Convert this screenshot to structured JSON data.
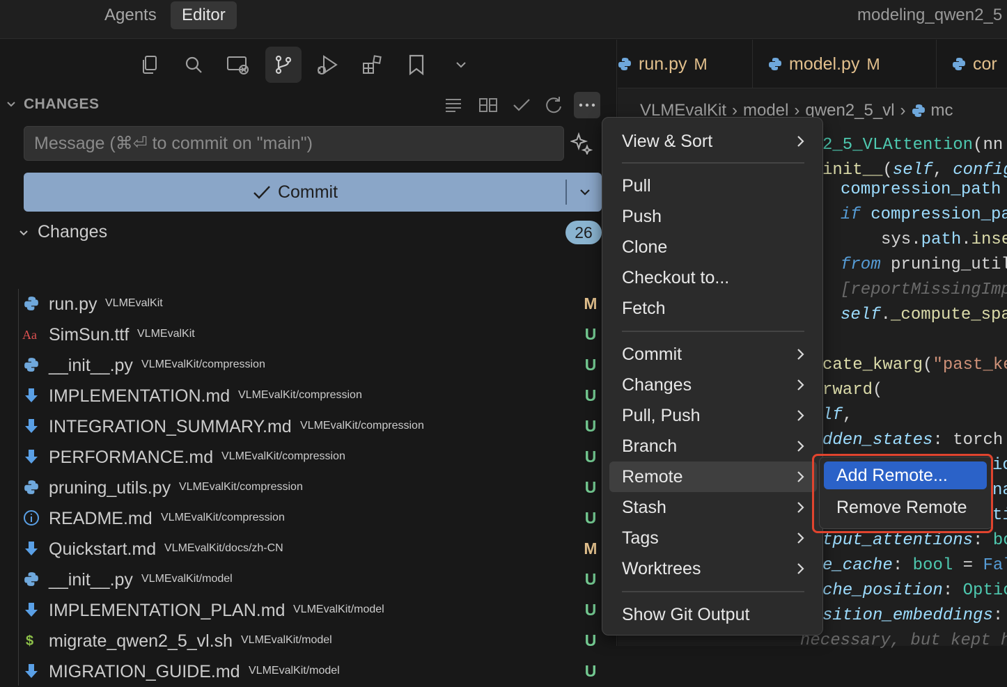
{
  "topbar": {
    "tabs": [
      {
        "label": "Agents"
      },
      {
        "label": "Editor"
      }
    ],
    "window_title": "modeling_qwen2_5"
  },
  "activity": {
    "icons": [
      "explorer-icon",
      "search-icon",
      "remote-explorer-icon",
      "source-control-icon",
      "run-debug-icon",
      "extensions-icon",
      "bookmark-icon",
      "chevron-down-icon"
    ],
    "active": "source-control-icon"
  },
  "scm": {
    "section_title": "CHANGES",
    "message_placeholder": "Message (⌘⏎ to commit on \"main\")",
    "commit_label": "Commit",
    "group": {
      "label": "Changes",
      "count": "26"
    },
    "files": [
      {
        "name": "run.py",
        "path": "VLMEvalKit",
        "status": "M",
        "icon": "python"
      },
      {
        "name": "SimSun.ttf",
        "path": "VLMEvalKit",
        "status": "U",
        "icon": "font"
      },
      {
        "name": "__init__.py",
        "path": "VLMEvalKit/compression",
        "status": "U",
        "icon": "python"
      },
      {
        "name": "IMPLEMENTATION.md",
        "path": "VLMEvalKit/compression",
        "status": "U",
        "icon": "markdown"
      },
      {
        "name": "INTEGRATION_SUMMARY.md",
        "path": "VLMEvalKit/compression",
        "status": "U",
        "icon": "markdown"
      },
      {
        "name": "PERFORMANCE.md",
        "path": "VLMEvalKit/compression",
        "status": "U",
        "icon": "markdown"
      },
      {
        "name": "pruning_utils.py",
        "path": "VLMEvalKit/compression",
        "status": "U",
        "icon": "python"
      },
      {
        "name": "README.md",
        "path": "VLMEvalKit/compression",
        "status": "U",
        "icon": "info"
      },
      {
        "name": "Quickstart.md",
        "path": "VLMEvalKit/docs/zh-CN",
        "status": "M",
        "icon": "markdown"
      },
      {
        "name": "__init__.py",
        "path": "VLMEvalKit/model",
        "status": "U",
        "icon": "python"
      },
      {
        "name": "IMPLEMENTATION_PLAN.md",
        "path": "VLMEvalKit/model",
        "status": "U",
        "icon": "markdown"
      },
      {
        "name": "migrate_qwen2_5_vl.sh",
        "path": "VLMEvalKit/model",
        "status": "U",
        "icon": "shell"
      },
      {
        "name": "MIGRATION_GUIDE.md",
        "path": "VLMEvalKit/model",
        "status": "U",
        "icon": "markdown"
      }
    ]
  },
  "editor": {
    "tabs": [
      {
        "name": "run.py",
        "status": "M"
      },
      {
        "name": "model.py",
        "status": "M"
      },
      {
        "name": "cor"
      }
    ],
    "breadcrumb": [
      "VLMEvalKit",
      "model",
      "qwen2_5_vl",
      "mc"
    ]
  },
  "menu": {
    "items": [
      {
        "label": "View & Sort",
        "submenu": true
      },
      {
        "label": "Pull"
      },
      {
        "label": "Push"
      },
      {
        "label": "Clone"
      },
      {
        "label": "Checkout to..."
      },
      {
        "label": "Fetch"
      },
      {
        "label": "Commit",
        "submenu": true
      },
      {
        "label": "Changes",
        "submenu": true
      },
      {
        "label": "Pull, Push",
        "submenu": true
      },
      {
        "label": "Branch",
        "submenu": true
      },
      {
        "label": "Remote",
        "submenu": true,
        "highlighted": true
      },
      {
        "label": "Stash",
        "submenu": true
      },
      {
        "label": "Tags",
        "submenu": true
      },
      {
        "label": "Worktrees",
        "submenu": true
      },
      {
        "label": "Show Git Output"
      }
    ],
    "submenu": {
      "items": [
        {
          "label": "Add Remote...",
          "selected": true
        },
        {
          "label": "Remove Remote"
        }
      ]
    }
  },
  "colors": {
    "accent": "#2b62c8",
    "commit_button": "#8aa6c8",
    "modified": "#e2c08d",
    "untracked": "#73c991",
    "highlight_box": "#e0442e"
  }
}
